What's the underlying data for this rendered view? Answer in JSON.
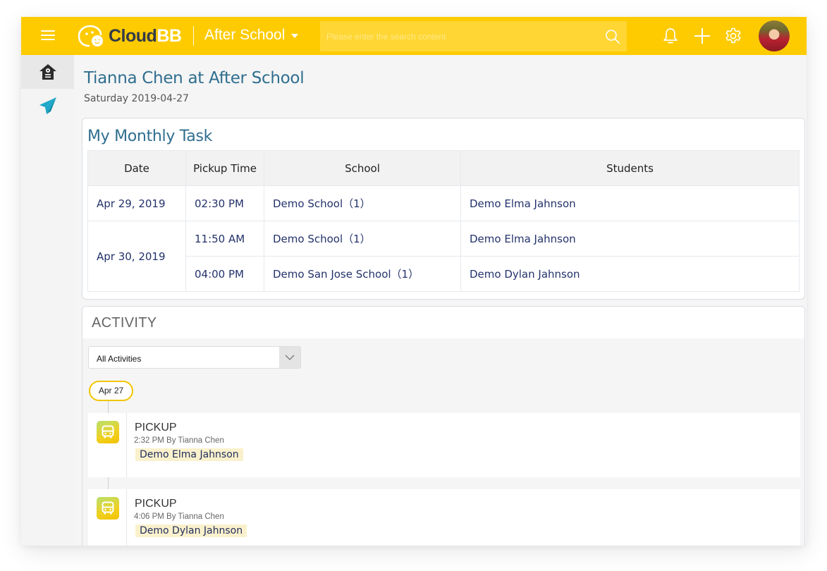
{
  "topbar": {
    "brand_primary": "Cloud",
    "brand_secondary": "BB",
    "org_name": "After School",
    "search_placeholder": "Please enter the search content",
    "search_value": "",
    "accent_color": "#fecb00",
    "icons": [
      "menu-icon",
      "search-icon",
      "bell-icon",
      "plus-icon",
      "gear-icon",
      "avatar"
    ]
  },
  "sidebar": {
    "items": [
      {
        "name": "home",
        "icon": "school-house-icon",
        "active": true
      },
      {
        "name": "messages",
        "icon": "paper-plane-icon",
        "active": false
      }
    ]
  },
  "page": {
    "title": "Tianna Chen at After School",
    "date": "Saturday 2019-04-27"
  },
  "monthly_task": {
    "title": "My Monthly Task",
    "columns": [
      "Date",
      "Pickup Time",
      "School",
      "Students"
    ],
    "groups": [
      {
        "date": "Apr 29, 2019",
        "rows": [
          {
            "time": "02:30 PM",
            "school": "Demo School（1）",
            "student": "Demo Elma Jahnson"
          }
        ]
      },
      {
        "date": "Apr 30, 2019",
        "rows": [
          {
            "time": "11:50 AM",
            "school": "Demo School（1）",
            "student": "Demo Elma Jahnson"
          },
          {
            "time": "04:00 PM",
            "school": "Demo San Jose School（1）",
            "student": "Demo Dylan Jahnson"
          }
        ]
      }
    ]
  },
  "activity": {
    "title": "ACTIVITY",
    "filter_value": "All Activities",
    "date_label": "Apr 27",
    "items": [
      {
        "type": "PICKUP",
        "meta": "2:32 PM By Tianna Chen",
        "student": "Demo Elma Jahnson",
        "icon": "bus-icon"
      },
      {
        "type": "PICKUP",
        "meta": "4:06 PM By Tianna Chen",
        "student": "Demo Dylan Jahnson",
        "icon": "bus-icon"
      }
    ]
  }
}
